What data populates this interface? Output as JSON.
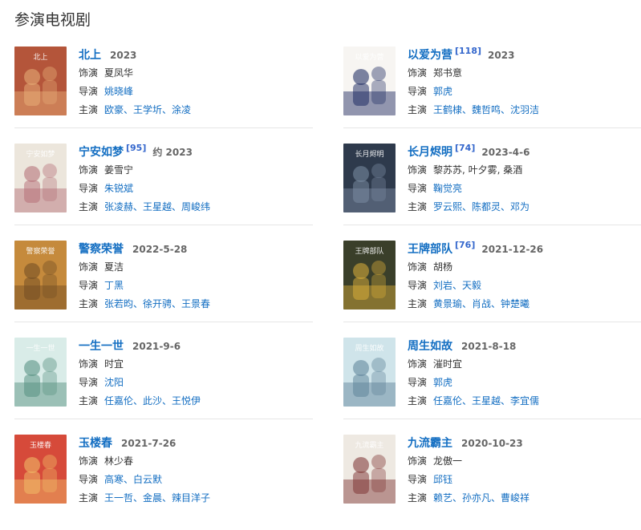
{
  "section_title": "参演电视剧",
  "labels": {
    "role": "饰演",
    "director": "导演",
    "cast": "主演"
  },
  "dramas": [
    {
      "title": "北上",
      "ref": "",
      "year": "2023",
      "role": "夏凤华",
      "director": "姚晓峰",
      "cast": "欧豪、王学圻、涂凌",
      "poster": {
        "bg": "#b4553a",
        "accent": "#e9b27a",
        "text": "北上"
      }
    },
    {
      "title": "以爱为营",
      "ref": "[118]",
      "year": "2023",
      "role": "郑书意",
      "director": "郭虎",
      "cast": "王鹤棣、魏哲鸣、沈羽洁",
      "poster": {
        "bg": "#f7f5f2",
        "accent": "#14215b",
        "text": "以爱为营"
      }
    },
    {
      "title": "宁安如梦",
      "ref": "[95]",
      "year": "约 2023",
      "role": "姜雪宁",
      "director": "朱锐斌",
      "cast": "张凌赫、王星越、周峻纬",
      "poster": {
        "bg": "#ece6dc",
        "accent": "#b36a73",
        "text": "宁安如梦"
      }
    },
    {
      "title": "长月烬明",
      "ref": "[74]",
      "year": "2023-4-6",
      "role": "黎苏苏, 叶夕雾, 桑酒",
      "director": "鞠觉亮",
      "cast": "罗云熙、陈都灵、邓为",
      "poster": {
        "bg": "#2e3a4c",
        "accent": "#7e8fa6",
        "text": "长月烬明"
      }
    },
    {
      "title": "警察荣誉",
      "ref": "",
      "year": "2022-5-28",
      "role": "夏洁",
      "director": "丁黑",
      "cast": "张若昀、徐开骋、王景春",
      "poster": {
        "bg": "#c58a3c",
        "accent": "#6e4a22",
        "text": "警察荣誉"
      }
    },
    {
      "title": "王牌部队",
      "ref": "[76]",
      "year": "2021-12-26",
      "role": "胡杨",
      "director": "刘岩、天毅",
      "cast": "黄景瑜、肖战、钟楚曦",
      "poster": {
        "bg": "#3a3f2a",
        "accent": "#e0b23a",
        "text": "王牌部队"
      }
    },
    {
      "title": "一生一世",
      "ref": "",
      "year": "2021-9-6",
      "role": "时宜",
      "director": "沈阳",
      "cast": "任嘉伦、此沙、王悦伊",
      "poster": {
        "bg": "#d9ece8",
        "accent": "#4f8c7b",
        "text": "一生一世"
      }
    },
    {
      "title": "周生如故",
      "ref": "",
      "year": "2021-8-18",
      "role": "漼时宜",
      "director": "郭虎",
      "cast": "任嘉伦、王星越、李宜儒",
      "poster": {
        "bg": "#cfe4ea",
        "accent": "#5a7f96",
        "text": "周生如故"
      }
    },
    {
      "title": "玉楼春",
      "ref": "",
      "year": "2021-7-26",
      "role": "林少春",
      "director": "高寒、白云默",
      "cast": "王一哲、金晨、辣目洋子",
      "poster": {
        "bg": "#d64a3a",
        "accent": "#f2c26a",
        "text": "玉楼春"
      }
    },
    {
      "title": "九流霸主",
      "ref": "",
      "year": "2020-10-23",
      "role": "龙傲一",
      "director": "邱钰",
      "cast": "赖艺、孙亦凡、曹峻祥",
      "poster": {
        "bg": "#eee9e2",
        "accent": "#7a2e2e",
        "text": "九流霸主"
      }
    }
  ]
}
